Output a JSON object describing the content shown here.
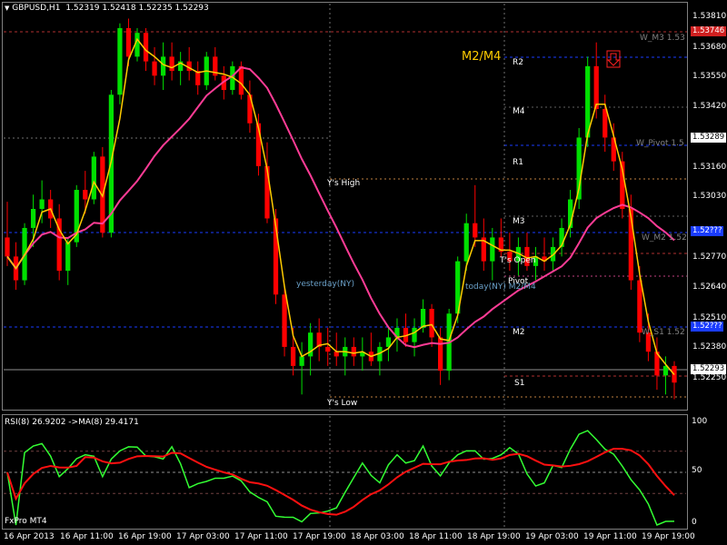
{
  "header": {
    "symbol": "GBPUSD,H1",
    "ohlc": "1.52319 1.52418 1.52235 1.52293"
  },
  "subwindow": {
    "title": "RSI(8) 26.9202 ->MA(8) 29.4171",
    "levels": [
      "100",
      "50",
      "0"
    ],
    "broker": "FxPro MT4"
  },
  "axis": {
    "price_ticks": [
      "1.53810",
      "1.53680",
      "1.53550",
      "1.53420",
      "1.53160",
      "1.53030",
      "1.52770",
      "1.52640",
      "1.52510",
      "1.52380",
      "1.52250"
    ],
    "time_ticks": [
      "16 Apr 2013",
      "16 Apr 11:00",
      "16 Apr 19:00",
      "17 Apr 03:00",
      "17 Apr 11:00",
      "17 Apr 19:00",
      "18 Apr 03:00",
      "18 Apr 11:00",
      "18 Apr 19:00",
      "19 Apr 03:00",
      "19 Apr 11:00",
      "19 Apr 19:00"
    ],
    "badges": {
      "top": "1.53746",
      "pivot": "1.53289",
      "m2": "1.52???",
      "s1": "1.52???",
      "bid": "1.52293"
    }
  },
  "labels": {
    "m2m4": "M2/M4",
    "r2": "R2",
    "m4": "M4",
    "r1": "R1",
    "m3": "M3",
    "m2": "M2",
    "s1": "S1",
    "pivot": "Pivot",
    "ts_open": "T's Open",
    "ys_high": "Y's High",
    "ys_low": "Y's Low",
    "yesterday": "yesterday(NY)",
    "today": "today(NY) M2/M4",
    "w_m3": "W_M3 1.53",
    "w_pivot": "W_Pivot 1.5",
    "w_m2": "W_M2 1.52",
    "w_s1": "W_S1 1.52"
  },
  "colors": {
    "up": "#00e000",
    "down": "#ff0000",
    "fast_ma": "#ffcc00",
    "slow_ma": "#ff3c96",
    "rsi": "#33ff33",
    "rsi_ma": "#ff1010",
    "blue_level": "#1a3cff",
    "red_level": "#b03030",
    "arrow": "#ff2020"
  },
  "chart_data": {
    "type": "candlestick",
    "symbol": "GBPUSD",
    "timeframe": "H1",
    "ylim": [
      1.5218,
      1.5386
    ],
    "indicators": [
      "MA fast",
      "MA slow",
      "RSI(8)",
      "MA(8) of RSI"
    ],
    "points": [
      [
        1.529,
        1.5305,
        1.5278,
        1.5282
      ],
      [
        1.5282,
        1.5288,
        1.5268,
        1.5272
      ],
      [
        1.5272,
        1.5296,
        1.527,
        1.5294
      ],
      [
        1.5294,
        1.5308,
        1.5286,
        1.5302
      ],
      [
        1.5302,
        1.5314,
        1.5296,
        1.5306
      ],
      [
        1.5306,
        1.531,
        1.5294,
        1.5298
      ],
      [
        1.5298,
        1.5304,
        1.5272,
        1.5276
      ],
      [
        1.5276,
        1.529,
        1.527,
        1.5288
      ],
      [
        1.5288,
        1.5312,
        1.5286,
        1.531
      ],
      [
        1.531,
        1.5318,
        1.53,
        1.5306
      ],
      [
        1.5306,
        1.5326,
        1.5304,
        1.5324
      ],
      [
        1.5324,
        1.5328,
        1.529,
        1.5292
      ],
      [
        1.5292,
        1.5352,
        1.529,
        1.535
      ],
      [
        1.535,
        1.538,
        1.5346,
        1.5378
      ],
      [
        1.5378,
        1.5382,
        1.5362,
        1.5366
      ],
      [
        1.5366,
        1.5378,
        1.5364,
        1.5376
      ],
      [
        1.5376,
        1.5378,
        1.536,
        1.5364
      ],
      [
        1.5364,
        1.537,
        1.5354,
        1.5358
      ],
      [
        1.5358,
        1.5372,
        1.5352,
        1.5366
      ],
      [
        1.5366,
        1.5372,
        1.5356,
        1.536
      ],
      [
        1.536,
        1.5368,
        1.5354,
        1.5364
      ],
      [
        1.5364,
        1.537,
        1.5356,
        1.536
      ],
      [
        1.536,
        1.5364,
        1.535,
        1.5354
      ],
      [
        1.5354,
        1.5368,
        1.5352,
        1.5366
      ],
      [
        1.5366,
        1.537,
        1.5356,
        1.5358
      ],
      [
        1.5358,
        1.5362,
        1.5348,
        1.5352
      ],
      [
        1.5352,
        1.5364,
        1.535,
        1.5362
      ],
      [
        1.5362,
        1.5364,
        1.5348,
        1.535
      ],
      [
        1.535,
        1.5356,
        1.5334,
        1.5338
      ],
      [
        1.5338,
        1.5342,
        1.5316,
        1.532
      ],
      [
        1.532,
        1.533,
        1.5296,
        1.5298
      ],
      [
        1.5298,
        1.5302,
        1.5262,
        1.5266
      ],
      [
        1.5266,
        1.527,
        1.524,
        1.5244
      ],
      [
        1.5244,
        1.5252,
        1.5232,
        1.5236
      ],
      [
        1.5236,
        1.5246,
        1.5224,
        1.524
      ],
      [
        1.524,
        1.5254,
        1.5232,
        1.525
      ],
      [
        1.525,
        1.5256,
        1.5238,
        1.5244
      ],
      [
        1.5244,
        1.5252,
        1.5236,
        1.5242
      ],
      [
        1.5242,
        1.525,
        1.5236,
        1.524
      ],
      [
        1.524,
        1.5248,
        1.5232,
        1.5244
      ],
      [
        1.5244,
        1.5248,
        1.5236,
        1.524
      ],
      [
        1.524,
        1.5248,
        1.5234,
        1.5242
      ],
      [
        1.5242,
        1.525,
        1.5236,
        1.5238
      ],
      [
        1.5238,
        1.5246,
        1.5232,
        1.5244
      ],
      [
        1.5244,
        1.5252,
        1.5238,
        1.5248
      ],
      [
        1.5248,
        1.5256,
        1.5242,
        1.5252
      ],
      [
        1.5252,
        1.5258,
        1.5244,
        1.5246
      ],
      [
        1.5246,
        1.5256,
        1.524,
        1.5252
      ],
      [
        1.5252,
        1.5264,
        1.525,
        1.526
      ],
      [
        1.526,
        1.5262,
        1.5244,
        1.5248
      ],
      [
        1.5248,
        1.5252,
        1.5228,
        1.5234
      ],
      [
        1.5234,
        1.526,
        1.523,
        1.5258
      ],
      [
        1.5258,
        1.5282,
        1.5254,
        1.528
      ],
      [
        1.528,
        1.53,
        1.5276,
        1.5296
      ],
      [
        1.5296,
        1.5312,
        1.5286,
        1.529
      ],
      [
        1.529,
        1.5298,
        1.5276,
        1.528
      ],
      [
        1.528,
        1.5294,
        1.5272,
        1.529
      ],
      [
        1.529,
        1.5298,
        1.5282,
        1.5284
      ],
      [
        1.5284,
        1.5292,
        1.5276,
        1.528
      ],
      [
        1.528,
        1.529,
        1.5274,
        1.5286
      ],
      [
        1.5286,
        1.5292,
        1.5276,
        1.5278
      ],
      [
        1.5278,
        1.5286,
        1.5272,
        1.5282
      ],
      [
        1.5282,
        1.529,
        1.5276,
        1.528
      ],
      [
        1.528,
        1.529,
        1.5276,
        1.5286
      ],
      [
        1.5286,
        1.5298,
        1.5282,
        1.5294
      ],
      [
        1.5294,
        1.531,
        1.529,
        1.5306
      ],
      [
        1.5306,
        1.5336,
        1.5302,
        1.5332
      ],
      [
        1.5332,
        1.5366,
        1.5328,
        1.5362
      ],
      [
        1.5362,
        1.5372,
        1.534,
        1.5344
      ],
      [
        1.5344,
        1.535,
        1.5326,
        1.5332
      ],
      [
        1.5332,
        1.5338,
        1.5318,
        1.5322
      ],
      [
        1.5322,
        1.5326,
        1.5298,
        1.5302
      ],
      [
        1.5302,
        1.5308,
        1.5268,
        1.5272
      ],
      [
        1.5272,
        1.5278,
        1.5246,
        1.525
      ],
      [
        1.525,
        1.5258,
        1.5238,
        1.5242
      ],
      [
        1.5242,
        1.5248,
        1.5226,
        1.5232
      ],
      [
        1.5232,
        1.524,
        1.5224,
        1.5236
      ],
      [
        1.5236,
        1.5238,
        1.5222,
        1.5229
      ]
    ]
  }
}
